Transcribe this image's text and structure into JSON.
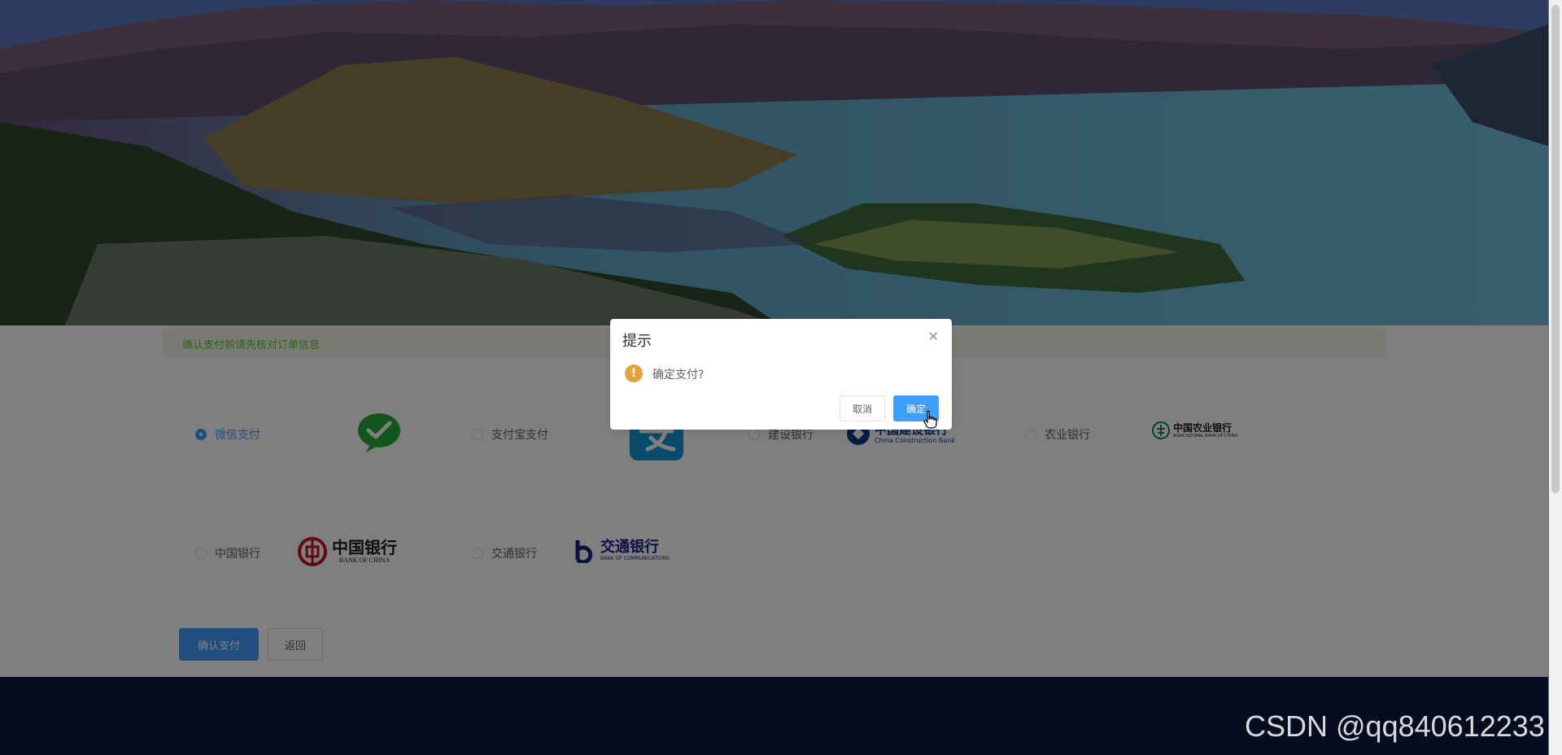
{
  "notice": {
    "text": "确认支付前请先核对订单信息"
  },
  "payment_options": [
    {
      "label": "微信支付",
      "checked": true,
      "logo": "wechat-pay-logo"
    },
    {
      "label": "支付宝支付",
      "checked": false,
      "logo": "alipay-logo"
    },
    {
      "label": "建设银行",
      "checked": false,
      "logo": "ccb-logo",
      "logo_text": "中国建设银行",
      "logo_sub": "China Construction Bank"
    },
    {
      "label": "农业银行",
      "checked": false,
      "logo": "abc-logo",
      "logo_text": "中国农业银行",
      "logo_sub": "AGRICULTURAL BANK OF CHINA"
    },
    {
      "label": "中国银行",
      "checked": false,
      "logo": "boc-logo",
      "logo_text": "中国银行",
      "logo_sub": "BANK OF CHINA"
    },
    {
      "label": "交通银行",
      "checked": false,
      "logo": "bocom-logo",
      "logo_text": "交通银行",
      "logo_sub": "BANK OF COMMUNICATIONS"
    }
  ],
  "actions": {
    "confirm_label": "确认支付",
    "back_label": "返回"
  },
  "dialog": {
    "title": "提示",
    "close_icon": "close-icon",
    "message": "确定支付?",
    "warning_icon": "warning-icon",
    "cancel_label": "取消",
    "confirm_label": "确定"
  },
  "watermark": "CSDN @qq840612233",
  "colors": {
    "primary": "#409eff",
    "success_text": "#67c23a",
    "warning": "#e6a23c",
    "footer": "#0d1b3e"
  }
}
